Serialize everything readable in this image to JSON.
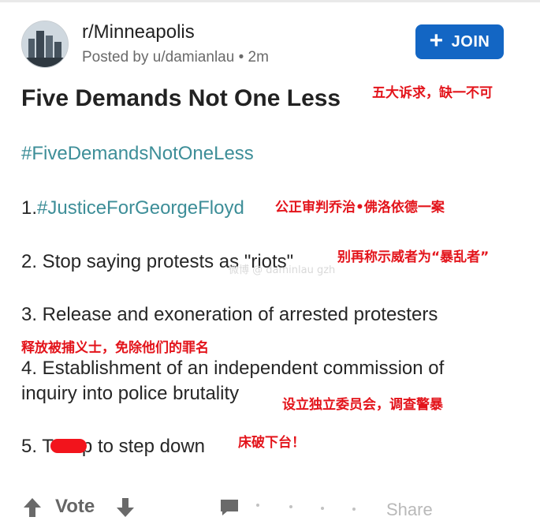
{
  "header": {
    "subreddit": "r/Minneapolis",
    "posted_by": "Posted by u/damianlau • 2m",
    "join_label": "JOIN"
  },
  "post": {
    "title": "Five Demands Not One Less",
    "hashtag": "#FiveDemandsNotOneLess",
    "items": [
      {
        "prefix": "1.",
        "link": "#JusticeForGeorgeFloyd"
      },
      {
        "text": "2. Stop saying protests as \"riots\""
      },
      {
        "text": "3. Release and exoneration of arrested protesters"
      },
      {
        "text": "4. Establishment of an independent commission of"
      },
      {
        "text": "inquiry into police brutality"
      },
      {
        "prefix": "5. T",
        "suffix": "p to step down"
      }
    ]
  },
  "annotations": {
    "title_note": "五大诉求，缺一不可",
    "item1_note": "公正审判乔治•佛洛依德一案",
    "item2_note": "别再称示威者为“暴乱者”",
    "item3_note": "释放被捕义士，免除他们的罪名",
    "item4_note": "设立独立委员会，调查警暴",
    "item5_note": "床破下台！"
  },
  "footer": {
    "vote_label": "Vote",
    "share_label": "Share"
  },
  "icons": [
    "city-avatar-icon",
    "plus-icon",
    "upvote-icon",
    "downvote-icon",
    "comment-icon"
  ],
  "colors": {
    "join_button": "#1366c4",
    "hashtag": "#3d8e98",
    "annotation_red": "#e3141b"
  }
}
